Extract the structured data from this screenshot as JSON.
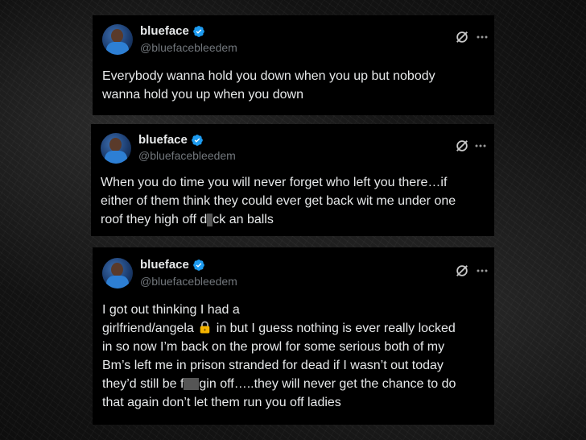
{
  "tweets": [
    {
      "display_name": "blueface",
      "handle": "@bluefacebleedem",
      "lines": [
        "Everybody wanna hold you down when you up but nobody",
        "wanna hold you up when you down"
      ]
    },
    {
      "display_name": "blueface",
      "handle": "@bluefacebleedem",
      "lines": [
        "When you do time you will never forget who left you there…if",
        "either of them think they could ever get back wit me under one"
      ],
      "line3_before": "roof they high off d",
      "line3_after": "ck an balls"
    },
    {
      "display_name": "blueface",
      "handle": "@bluefacebleedem",
      "line1": "I got out thinking I had a",
      "line2_before": "girlfriend/angela",
      "line2_after": "in but I guess nothing is ever really locked",
      "line3": "in so now I’m back on the prowl for some serious both of my",
      "line4": "Bm’s left me in prison stranded for dead if I wasn’t out today",
      "line5_before": "they’d still be f",
      "line5_after": "gin off…..they will never get the chance to do",
      "line6": "that again don’t let them run you off ladies"
    }
  ],
  "icons": {
    "verified": "verified-badge-icon",
    "grok": "grok-icon",
    "more": "more-options-icon",
    "lock": "lock-emoji"
  },
  "colors": {
    "verified_blue": "#1d9bf0",
    "text": "#e7e9ea",
    "secondary_text": "#71767b",
    "card_background": "#000000"
  }
}
